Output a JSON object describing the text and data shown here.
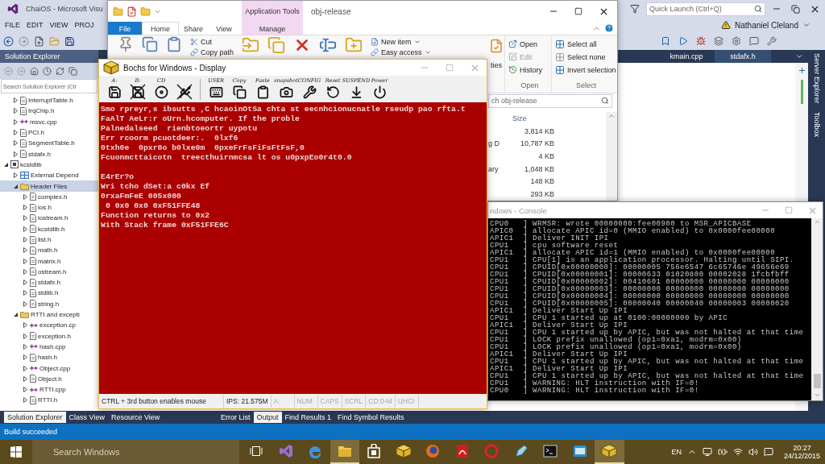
{
  "vs": {
    "title": "ChaiOS - Microsoft Visu",
    "menu": [
      "FILE",
      "EDIT",
      "VIEW",
      "PROJ"
    ],
    "quick_launch": {
      "placeholder": "Quick Launch (Ctrl+Q)"
    },
    "user": "Nathaniel Cleland",
    "solution_explorer": {
      "title": "Solution Explorer",
      "search": {
        "placeholder": "Search Solution Explorer (Ctr"
      },
      "tree": [
        {
          "children": [
            {
              "label": "InterruptTable.h",
              "kind": "header",
              "expanded": false,
              "selected": false
            },
            {
              "label": "IrqChip.h",
              "kind": "header",
              "expanded": false,
              "selected": false
            },
            {
              "label": "msvc.cpp",
              "kind": "source",
              "expanded": false,
              "selected": false
            },
            {
              "label": "PCI.h",
              "kind": "header",
              "expanded": false,
              "selected": false
            },
            {
              "label": "SegmentTable.h",
              "kind": "header",
              "expanded": false,
              "selected": false
            },
            {
              "label": "stdafx.h",
              "kind": "header",
              "expanded": false,
              "selected": false
            }
          ]
        },
        {
          "label": "kcstdlib",
          "kind": "project",
          "expanded": true,
          "selected": false,
          "children": [
            {
              "label": "External Depend",
              "kind": "references",
              "expanded": false,
              "selected": false
            },
            {
              "label": "Header Files",
              "kind": "folder",
              "expanded": true,
              "selected": true,
              "children": [
                {
                  "label": "complex.h",
                  "kind": "header",
                  "expanded": false,
                  "selected": false
                },
                {
                  "label": "ios.h",
                  "kind": "header",
                  "expanded": false,
                  "selected": false
                },
                {
                  "label": "iostream.h",
                  "kind": "header",
                  "expanded": false,
                  "selected": false
                },
                {
                  "label": "kcstdlib.h",
                  "kind": "header",
                  "expanded": false,
                  "selected": false
                },
                {
                  "label": "list.h",
                  "kind": "header",
                  "expanded": false,
                  "selected": false
                },
                {
                  "label": "math.h",
                  "kind": "header",
                  "expanded": false,
                  "selected": false
                },
                {
                  "label": "matrix.h",
                  "kind": "header",
                  "expanded": false,
                  "selected": false
                },
                {
                  "label": "ostream.h",
                  "kind": "header",
                  "expanded": false,
                  "selected": false
                },
                {
                  "label": "stdafx.h",
                  "kind": "header",
                  "expanded": false,
                  "selected": false
                },
                {
                  "label": "stdlib.h",
                  "kind": "header",
                  "expanded": false,
                  "selected": false
                },
                {
                  "label": "string.h",
                  "kind": "header",
                  "expanded": false,
                  "selected": false
                }
              ]
            },
            {
              "label": "RTTI and excepti",
              "kind": "folder",
              "expanded": true,
              "selected": false,
              "children": [
                {
                  "label": "exception.cp",
                  "kind": "source",
                  "expanded": false,
                  "selected": false
                },
                {
                  "label": "exception.h",
                  "kind": "header",
                  "expanded": false,
                  "selected": false
                },
                {
                  "label": "hash.cpp",
                  "kind": "source",
                  "expanded": false,
                  "selected": false
                },
                {
                  "label": "hash.h",
                  "kind": "header",
                  "expanded": false,
                  "selected": false
                },
                {
                  "label": "Object.cpp",
                  "kind": "source",
                  "expanded": false,
                  "selected": false
                },
                {
                  "label": "Object.h",
                  "kind": "header",
                  "expanded": false,
                  "selected": false
                },
                {
                  "label": "RTTI.cpp",
                  "kind": "source",
                  "expanded": false,
                  "selected": false
                },
                {
                  "label": "RTTI.h",
                  "kind": "header",
                  "expanded": false,
                  "selected": false
                }
              ]
            }
          ]
        }
      ]
    },
    "document_tabs": [
      {
        "label": "kmain.cpp",
        "selected": false
      },
      {
        "label": "stdafx.h",
        "selected": true
      }
    ],
    "side_tabs": [
      "Server Explorer",
      "Toolbox"
    ],
    "panel_tabs": [
      {
        "label": "Solution Explorer",
        "selected": true
      },
      {
        "label": "Class View",
        "selected": false
      },
      {
        "label": "Resource View",
        "selected": false
      }
    ],
    "output_tabs": [
      {
        "label": "Error List",
        "selected": false
      },
      {
        "label": "Output",
        "selected": true
      },
      {
        "label": "Find Results 1",
        "selected": false
      },
      {
        "label": "Find Symbol Results",
        "selected": false
      }
    ],
    "status_bar": "Build succeeded"
  },
  "explorer": {
    "title": "obj-release",
    "context_tab": "Application Tools",
    "tabs": [
      {
        "label": "File",
        "kind": "menu",
        "selected": false
      },
      {
        "label": "Home",
        "kind": "tab",
        "selected": true
      },
      {
        "label": "Share",
        "kind": "tab",
        "selected": false
      },
      {
        "label": "View",
        "kind": "tab",
        "selected": false
      },
      {
        "label": "Manage",
        "kind": "context",
        "selected": false
      }
    ],
    "clipboard": [
      "Cut",
      "Copy path"
    ],
    "new": [
      "New item",
      "Easy access"
    ],
    "properties_label": "ties",
    "open_group": {
      "label": "Open",
      "items": [
        {
          "label": "Open",
          "kind": "open",
          "disabled": false
        },
        {
          "label": "Edit",
          "kind": "edit",
          "disabled": true
        },
        {
          "label": "History",
          "kind": "history",
          "disabled": false
        }
      ]
    },
    "select_group": {
      "label": "Select",
      "items": [
        {
          "label": "Select all",
          "kind": "all"
        },
        {
          "label": "Select none",
          "kind": "none"
        },
        {
          "label": "Invert selection",
          "kind": "invert"
        }
      ]
    },
    "search": {
      "placeholder": "ch obj-release"
    },
    "columns": [
      "Size"
    ],
    "rows": [
      {
        "size": "3,814 KB"
      },
      {
        "type": "g D",
        "size": "10,787 KB"
      },
      {
        "size": "4 KB"
      },
      {
        "type": "ary",
        "size": "1,048 KB"
      },
      {
        "size": "148 KB"
      },
      {
        "size": "293 KB"
      }
    ]
  },
  "bochs": {
    "title": "Bochs for Windows - Display",
    "toolbar": [
      {
        "label": "A:",
        "kind": "floppy",
        "disabled": false
      },
      {
        "label": "B:",
        "kind": "floppy",
        "disabled": true
      },
      {
        "label": "CD",
        "kind": "cdrom",
        "disabled": false
      },
      {
        "kind": "usb",
        "disabled": true
      },
      {
        "label": "USER",
        "kind": "keyboard",
        "disabled": false
      },
      {
        "label": "Copy",
        "kind": "copy",
        "disabled": false
      },
      {
        "label": "Paste",
        "kind": "paste",
        "disabled": false
      },
      {
        "label": "snapshot",
        "kind": "snapshot",
        "disabled": false
      },
      {
        "label": "CONFIG",
        "kind": "config",
        "disabled": false
      },
      {
        "label": "Reset",
        "kind": "reset",
        "disabled": false
      },
      {
        "label": "SUSPEND",
        "kind": "suspend",
        "disabled": false
      },
      {
        "label": "Power",
        "kind": "power",
        "disabled": false
      }
    ],
    "screen": [
      [
        "Smo rpreyr,s ibsutts ,C hcaoinOtSa chta st eecnhcionucnatle rseudp pao rfta.t",
        "FaAlT AeLr:r oUrn.hcomputer. If the proble",
        "Palnedalseed  rienbtoeortr uypotu",
        "Err rcoorm pcuotdeer:.  0lxf6",
        "0txh0e  0pxr0o b0lxe0m  0pxeFrFsFiFsFtFsF,0",
        "Fcuonmcttaicotn  treecthuirnmcsa lt os u0pxpEo0r4t0.0"
      ],
      [
        "E4rEr?o",
        "Wri tcho dSet:a c0kx Ef",
        "0rxaFmFeE 005x000",
        " 0 0x0 0x0 0xF51FFE48",
        "Function returns to 0x2",
        "With Stack frame 0xF51FFE6C"
      ]
    ],
    "status": [
      {
        "text": "CTRL + 3rd button enables mouse",
        "active": true
      },
      {
        "text": "IPS: 21.575M",
        "active": true
      },
      {
        "text": "A:",
        "active": false
      },
      {
        "text": "NUM",
        "active": false
      },
      {
        "text": "CAPS",
        "active": false
      },
      {
        "text": "SCRL",
        "active": false
      },
      {
        "text": "CD:0-M",
        "active": false
      },
      {
        "text": "UHCI",
        "active": false
      }
    ]
  },
  "console": {
    "title": "ndows - Console",
    "lines": [
      "CPU0   ] WRMSR: wrote 00000000:fee00900 to MSR_APICBASE",
      "APIC0  ] allocate APIC id=0 (MMIO enabled) to 0x0000fee00000",
      "APIC1  ] Deliver INIT IPI",
      "CPU1   ] cpu software reset",
      "APIC1  ] allocate APIC id=1 (MMIO enabled) to 0x0000fee00000",
      "CPU1   ] CPU[1] is an application processor. Halting until SIPI.",
      "CPU1   ] CPUID[0x00000000]: 00000005 756e6547 6c65746e 49656e69",
      "CPU1   ] CPUID[0x00000001]: 00000633 01020800 00002028 1fcbfbff",
      "CPU1   ] CPUID[0x00000002]: 00410601 00000000 00000000 00000000",
      "CPU1   ] CPUID[0x00000003]: 00000000 00000000 00000000 00000000",
      "CPU1   ] CPUID[0x00000004]: 00000000 00000000 00000000 00000000",
      "CPU1   ] CPUID[0x00000005]: 00000040 00000040 00000003 00000020",
      "APIC1  ] Deliver Start Up IPI",
      "CPU1   ] CPU 1 started up at 0100:00000000 by APIC",
      "APIC1  ] Deliver Start Up IPI",
      "CPU1   ] CPU 1 started up by APIC, but was not halted at that time",
      "CPU1   ] LOCK prefix unallowed (op1=0xa1, modrm=0x00)",
      "CPU1   ] LOCK prefix unallowed (op1=0xa1, modrm=0x00)",
      "APIC1  ] Deliver Start Up IPI",
      "CPU1   ] CPU 1 started up by APIC, but was not halted at that time",
      "APIC1  ] Deliver Start Up IPI",
      "CPU1   ] CPU 1 started up by APIC, but was not halted at that time",
      "CPU1   ] WARNING: HLT instruction with IF=0!",
      "CPU0   ] WARNING: HLT instruction with IF=0!"
    ]
  },
  "taskbar": {
    "search": {
      "placeholder": "Search Windows"
    },
    "apps": [
      {
        "kind": "task-view",
        "active": false
      },
      {
        "kind": "infinity",
        "active": false
      },
      {
        "kind": "swirl",
        "active": false
      },
      {
        "kind": "folder",
        "active": true
      },
      {
        "kind": "bag",
        "active": false
      },
      {
        "kind": "box",
        "active": false
      },
      {
        "kind": "globe",
        "active": false
      },
      {
        "kind": "document",
        "active": false
      },
      {
        "kind": "ring",
        "active": false
      },
      {
        "kind": "pen",
        "active": false
      },
      {
        "kind": "terminal",
        "active": false
      },
      {
        "kind": "tile",
        "active": false
      },
      {
        "kind": "box",
        "active": true
      }
    ],
    "language": "EN",
    "time": "20:27",
    "date": "24/12/2015"
  }
}
